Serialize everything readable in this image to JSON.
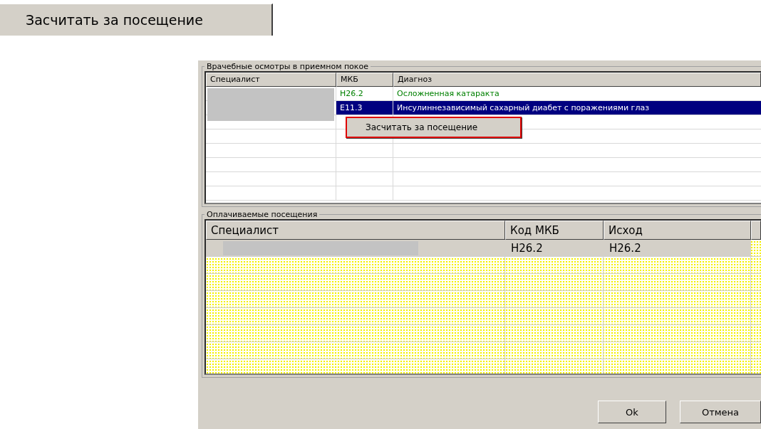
{
  "top_button": {
    "label": "Засчитать за посещение"
  },
  "exams": {
    "title": "Врачебные осмотры в приемном покое",
    "columns": [
      "Специалист",
      "МКБ",
      "Диагноз"
    ],
    "rows": [
      {
        "mkb": "H26.2",
        "diagnosis": "Осложненная катаракта",
        "color": "#008000",
        "selected": false
      },
      {
        "mkb": "E11.3",
        "diagnosis": "Инсулиннезависимый сахарный диабет с поражениями глаз",
        "selected": true
      }
    ],
    "context_menu": [
      "Засчитать за посещение"
    ]
  },
  "visits": {
    "title": "Оплачиваемые посещения",
    "columns": [
      "Специалист",
      "Код МКБ",
      "Исход"
    ],
    "rows": [
      {
        "code": "H26.2",
        "outcome": "H26.2",
        "selected": true
      }
    ]
  },
  "buttons": [
    "Ok",
    "Отмена"
  ]
}
